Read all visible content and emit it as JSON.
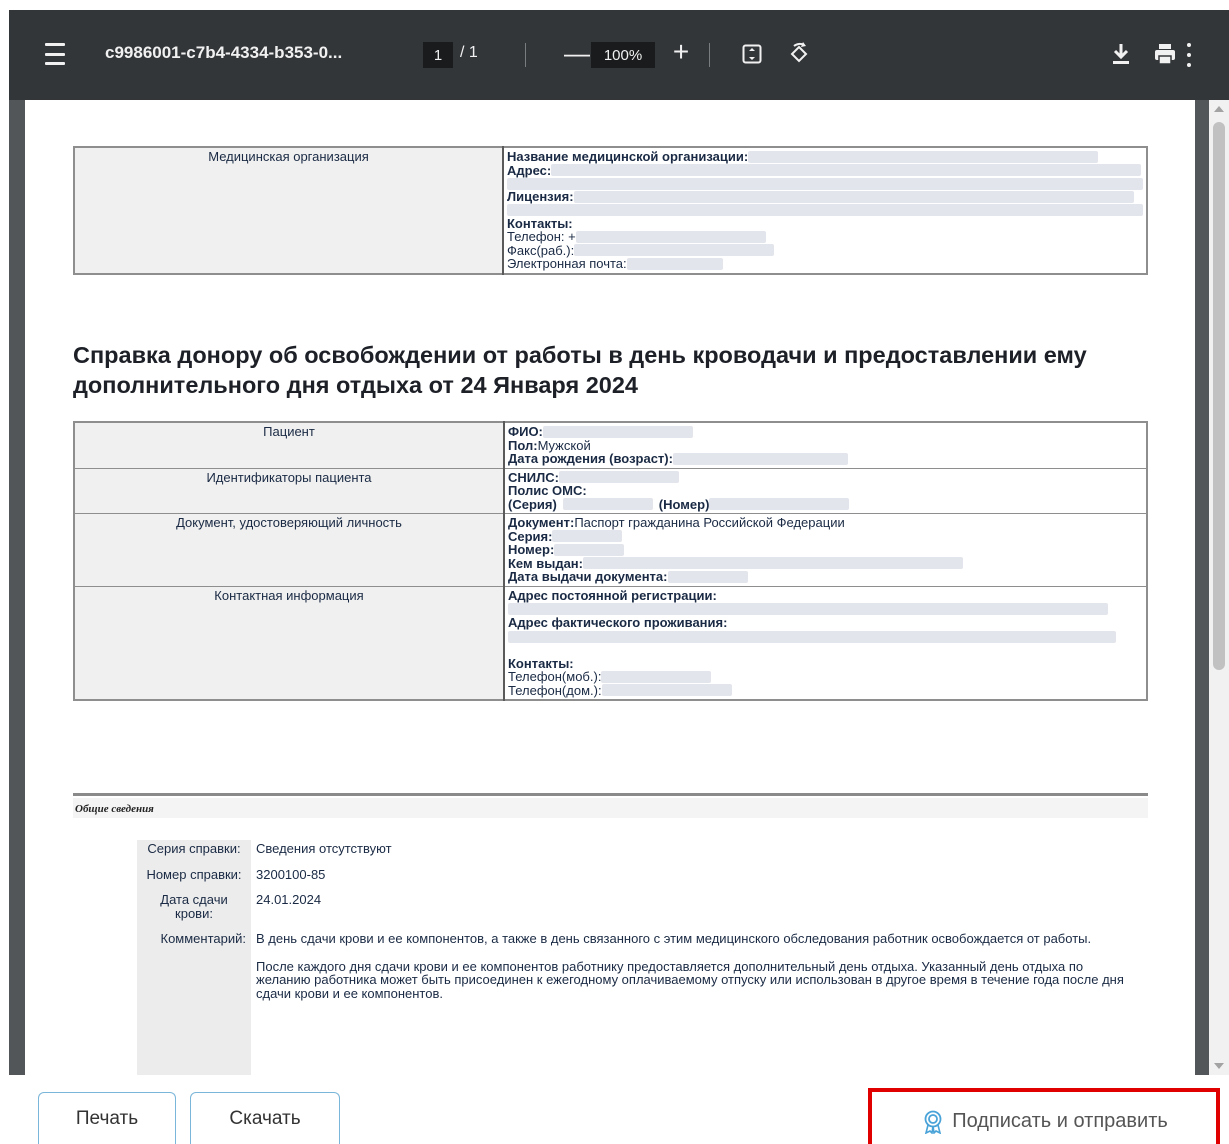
{
  "viewer": {
    "file_name": "c9986001-c7b4-4334-b353-0...",
    "page_current": "1",
    "page_total": "/ 1",
    "zoom": "100%",
    "zoom_out": "—",
    "zoom_in": "+"
  },
  "icons": [
    "menu-icon",
    "zoom-out-icon",
    "zoom-in-icon",
    "fit-page-icon",
    "rotate-icon",
    "download-icon",
    "print-icon",
    "more-icon",
    "certificate-icon"
  ],
  "org": {
    "label": "Медицинская организация",
    "name_label": "Название медицинской организации:",
    "address_label": "Адрес:",
    "license_label": "Лицензия:",
    "contacts_label": "Контакты:",
    "phone_label": "Телефон: +",
    "fax_label": "Факс(раб.):",
    "email_label": "Электронная почта:"
  },
  "heading": "Справка донору об освобождении от работы в день кроводачи и предоставлении ему дополнительного дня отдыха от 24 Января 2024",
  "patient": {
    "label": "Пациент",
    "fio_label": "ФИО:",
    "sex_label": "Пол:",
    "sex_value": " Мужской",
    "dob_label": "Дата рождения (возраст):",
    "ids_label": "Идентификаторы пациента",
    "snils_label": "СНИЛС:",
    "oms_label": "Полис ОМС:",
    "series_label": "(Серия)",
    "number_label": "(Номер)",
    "doc_label": "Документ, удостоверяющий личность",
    "document_label": "Документ:",
    "document_value": " Паспорт гражданина Российской Федерации",
    "doc_series_label": "Серия:",
    "doc_number_label": "Номер:",
    "issued_by_label": "Кем выдан:",
    "issue_date_label": "Дата выдачи документа:",
    "contact_label": "Контактная информация",
    "reg_address_label": "Адрес постоянной регистрации:",
    "fact_address_label": "Адрес фактического проживания:",
    "contacts_label": "Контакты:",
    "mobile_label": "Телефон(моб.):",
    "home_label": "Телефон(дом.):"
  },
  "general": {
    "section_title": "Общие сведения",
    "rows": [
      {
        "key": "Серия справки:",
        "value": "Сведения отсутствуют"
      },
      {
        "key": "Номер справки:",
        "value": "3200100-85"
      },
      {
        "key": "Дата сдачи крови:",
        "value": "24.01.2024"
      }
    ],
    "comment_key": "Комментарий:",
    "comment_p1": "В день сдачи крови и ее компонентов, а также в день связанного с этим медицинского обследования работник освобождается от работы.",
    "comment_p2": "После каждого дня сдачи крови и ее компонентов работнику предоставляется дополнительный день отдыха. Указанный день отдыха по желанию работника может быть присоединен к ежегодному оплачиваемому отпуску или использован в другое время в течение года после дня сдачи крови и ее компонентов."
  },
  "buttons": {
    "print": "Печать",
    "download": "Скачать",
    "sign_send": "Подписать и отправить"
  },
  "colors": {
    "toolbar": "#323639",
    "viewer_bg": "#525659",
    "highlight": "#e00000",
    "button_border": "#7ab6d9"
  }
}
